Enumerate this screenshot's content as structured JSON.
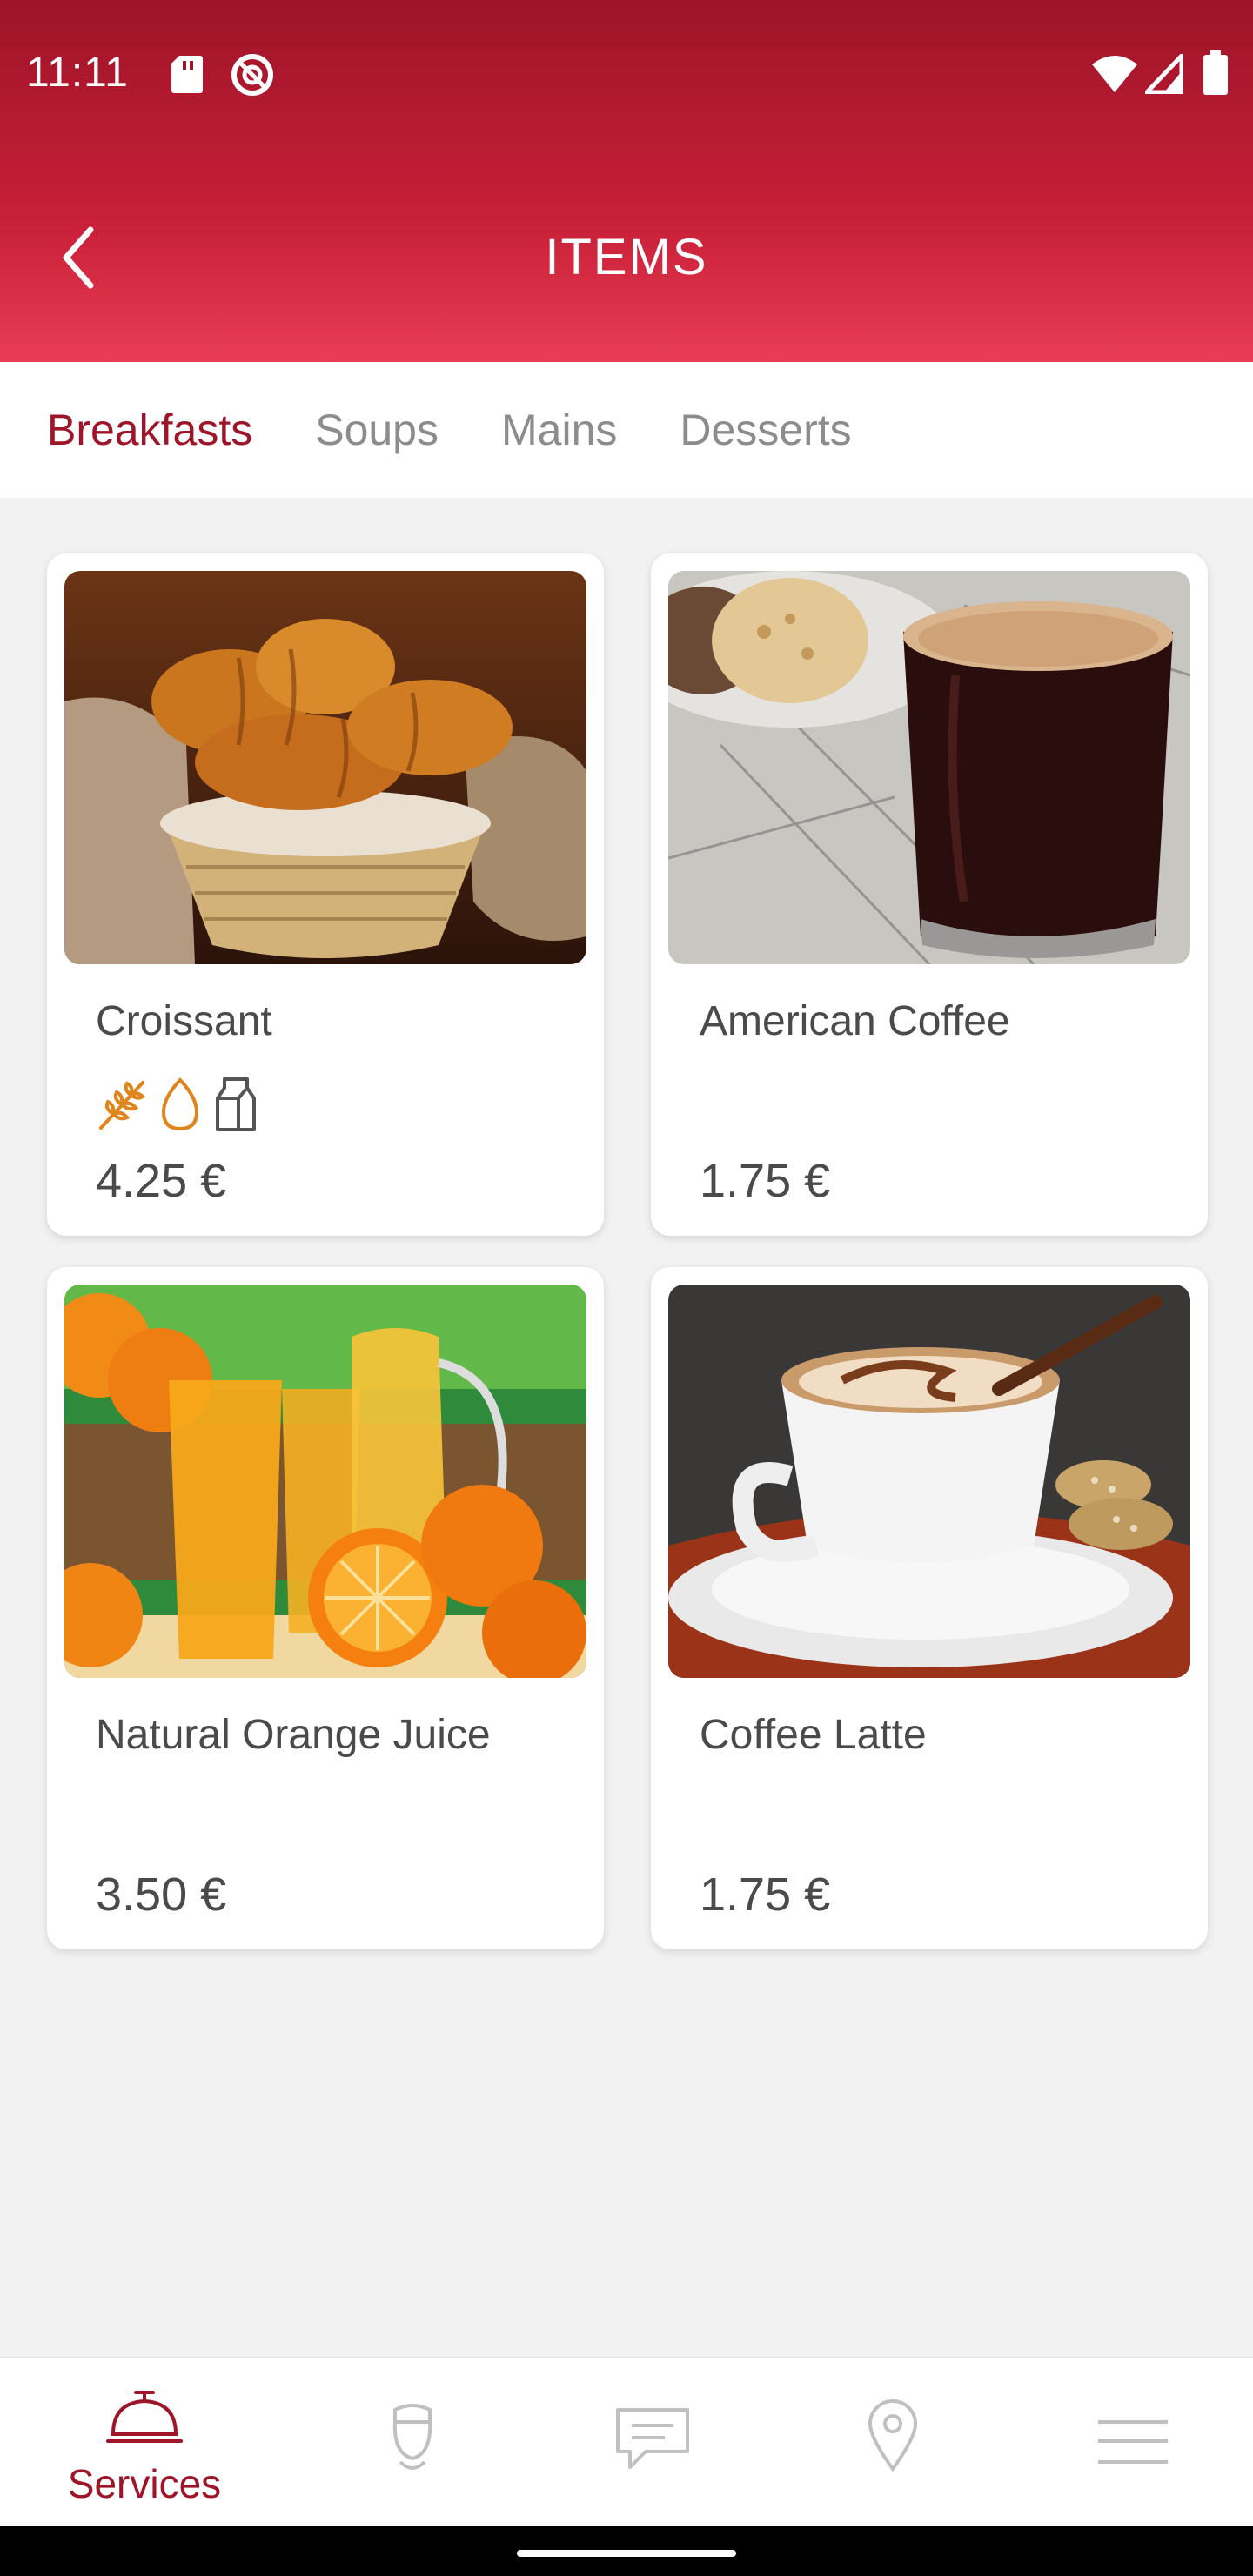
{
  "status_bar": {
    "time": "11:11"
  },
  "app_bar": {
    "title": "ITEMS"
  },
  "tabs": [
    {
      "label": "Breakfasts",
      "active": true
    },
    {
      "label": "Soups",
      "active": false
    },
    {
      "label": "Mains",
      "active": false
    },
    {
      "label": "Desserts",
      "active": false
    }
  ],
  "items": [
    {
      "name": "Croissant",
      "price": "4.25 €",
      "allergens": [
        "gluten-icon",
        "egg-icon",
        "milk-icon"
      ]
    },
    {
      "name": "American Coffee",
      "price": "1.75 €",
      "allergens": []
    },
    {
      "name": "Natural Orange Juice",
      "price": "3.50 €",
      "allergens": []
    },
    {
      "name": "Coffee Latte",
      "price": "1.75 €",
      "allergens": []
    }
  ],
  "bottom_nav": [
    {
      "label": "Services",
      "icon": "service-bell-icon",
      "active": true
    },
    {
      "label": "",
      "icon": "concierge-icon",
      "active": false
    },
    {
      "label": "",
      "icon": "chat-icon",
      "active": false
    },
    {
      "label": "",
      "icon": "location-pin-icon",
      "active": false
    },
    {
      "label": "",
      "icon": "menu-icon",
      "active": false
    }
  ],
  "colors": {
    "primary": "#9e1428",
    "accent": "#e83d55",
    "allergen": "#e0841c"
  }
}
